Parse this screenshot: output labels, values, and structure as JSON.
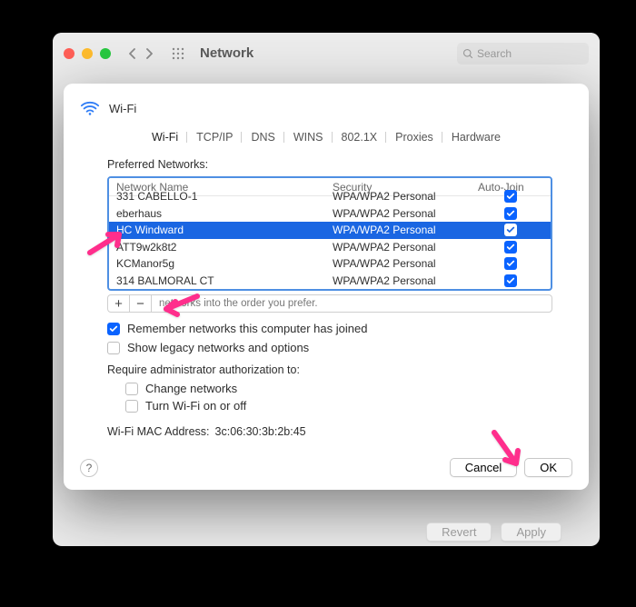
{
  "toolbar": {
    "title": "Network",
    "search_placeholder": "Search"
  },
  "sheet": {
    "title": "Wi-Fi"
  },
  "tabs": [
    "Wi-Fi",
    "TCP/IP",
    "DNS",
    "WINS",
    "802.1X",
    "Proxies",
    "Hardware"
  ],
  "preferred_label": "Preferred Networks:",
  "table": {
    "columns": [
      "Network Name",
      "Security",
      "Auto-Join"
    ],
    "rows": [
      {
        "name": "331 CABELLO-1",
        "security": "WPA/WPA2 Personal",
        "autojoin": true,
        "selected": false,
        "cut": true
      },
      {
        "name": "eberhaus",
        "security": "WPA/WPA2 Personal",
        "autojoin": true,
        "selected": false
      },
      {
        "name": "HC Windward",
        "security": "WPA/WPA2 Personal",
        "autojoin": true,
        "selected": true
      },
      {
        "name": "ATT9w2k8t2",
        "security": "WPA/WPA2 Personal",
        "autojoin": true,
        "selected": false
      },
      {
        "name": "KCManor5g",
        "security": "WPA/WPA2 Personal",
        "autojoin": true,
        "selected": false
      },
      {
        "name": "314 BALMORAL CT",
        "security": "WPA/WPA2 Personal",
        "autojoin": true,
        "selected": false
      }
    ]
  },
  "drag_hint": "networks into the order you prefer.",
  "checks": {
    "remember": {
      "label": "Remember networks this computer has joined",
      "checked": true
    },
    "legacy": {
      "label": "Show legacy networks and options",
      "checked": false
    }
  },
  "auth": {
    "label": "Require administrator authorization to:",
    "change": {
      "label": "Change networks",
      "checked": false
    },
    "toggle": {
      "label": "Turn Wi-Fi on or off",
      "checked": false
    }
  },
  "mac": {
    "label": "Wi-Fi MAC Address:",
    "value": "3c:06:30:3b:2b:45"
  },
  "buttons": {
    "cancel": "Cancel",
    "ok": "OK",
    "revert": "Revert",
    "apply": "Apply",
    "help": "?"
  }
}
